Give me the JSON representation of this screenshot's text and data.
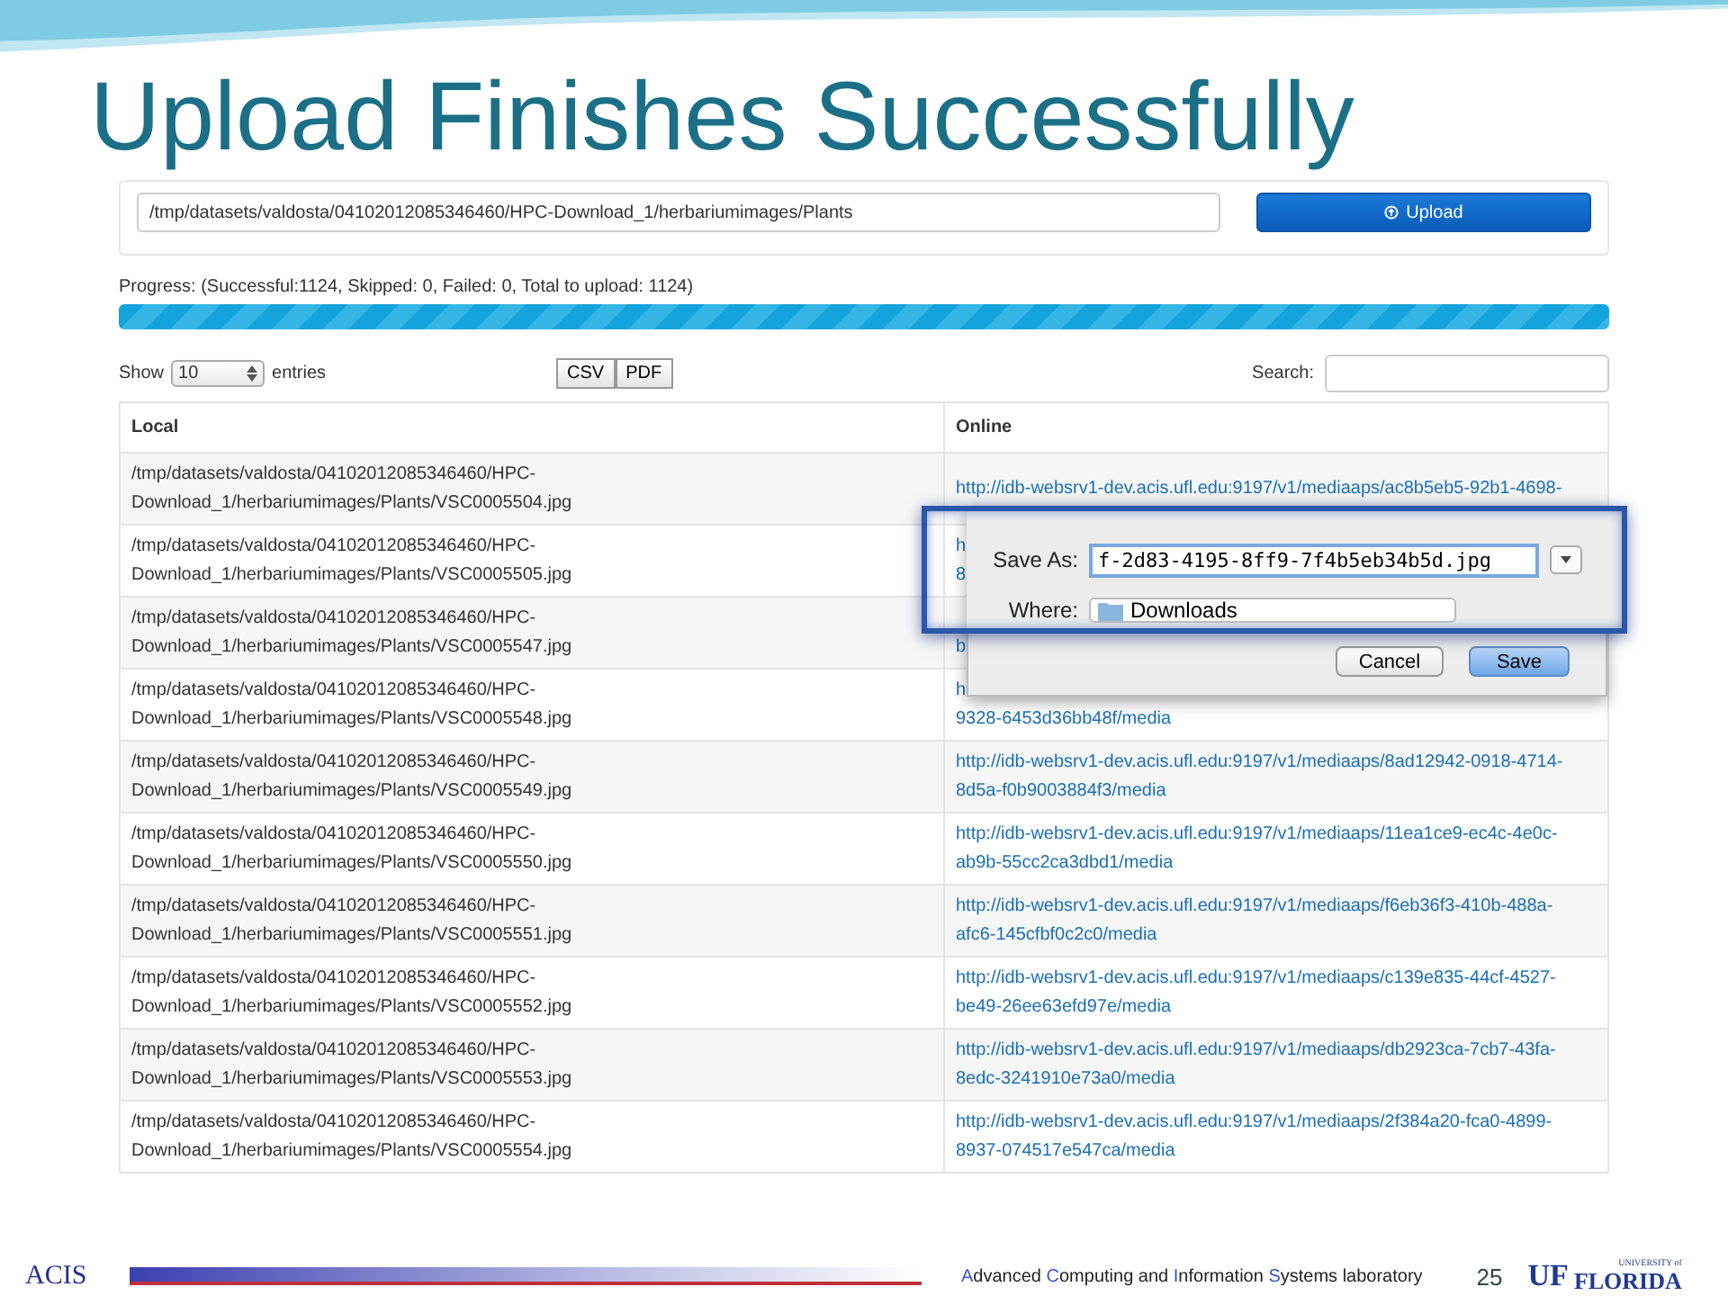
{
  "slide": {
    "title": "Upload Finishes Successfully",
    "number": "25"
  },
  "upload": {
    "path": "/tmp/datasets/valdosta/04102012085346460/HPC-Download_1/herbariumimages/Plants",
    "button": "Upload"
  },
  "progress": {
    "label": "Progress: (Successful:1124, Skipped: 0, Failed: 0, Total to upload: 1124)",
    "level": 1
  },
  "table_controls": {
    "show": "Show",
    "page_size": "10",
    "entries": "entries",
    "exports": [
      "CSV",
      "PDF"
    ],
    "search_label": "Search:"
  },
  "table": {
    "columns": [
      "Local",
      "Online"
    ],
    "rows": [
      {
        "local": "/tmp/datasets/valdosta/04102012085346460/HPC-\nDownload_1/herbariumimages/Plants/VSC0005504.jpg",
        "online": "http://idb-websrv1-dev.acis.ufl.edu:9197/v1/mediaaps/ac8b5eb5-92b1-4698-"
      },
      {
        "local": "/tmp/datasets/valdosta/04102012085346460/HPC-\nDownload_1/herbariumimages/Plants/VSC0005505.jpg",
        "online": "h\n8"
      },
      {
        "local": "/tmp/datasets/valdosta/04102012085346460/HPC-\nDownload_1/herbariumimages/Plants/VSC0005547.jpg",
        "online": "\nb"
      },
      {
        "local": "/tmp/datasets/valdosta/04102012085346460/HPC-\nDownload_1/herbariumimages/Plants/VSC0005548.jpg",
        "online": "h\n9328-6453d36bb48f/media"
      },
      {
        "local": "/tmp/datasets/valdosta/04102012085346460/HPC-\nDownload_1/herbariumimages/Plants/VSC0005549.jpg",
        "online": "http://idb-websrv1-dev.acis.ufl.edu:9197/v1/mediaaps/8ad12942-0918-4714-\n8d5a-f0b9003884f3/media"
      },
      {
        "local": "/tmp/datasets/valdosta/04102012085346460/HPC-\nDownload_1/herbariumimages/Plants/VSC0005550.jpg",
        "online": "http://idb-websrv1-dev.acis.ufl.edu:9197/v1/mediaaps/11ea1ce9-ec4c-4e0c-\nab9b-55cc2ca3dbd1/media"
      },
      {
        "local": "/tmp/datasets/valdosta/04102012085346460/HPC-\nDownload_1/herbariumimages/Plants/VSC0005551.jpg",
        "online": "http://idb-websrv1-dev.acis.ufl.edu:9197/v1/mediaaps/f6eb36f3-410b-488a-\nafc6-145cfbf0c2c0/media"
      },
      {
        "local": "/tmp/datasets/valdosta/04102012085346460/HPC-\nDownload_1/herbariumimages/Plants/VSC0005552.jpg",
        "online": "http://idb-websrv1-dev.acis.ufl.edu:9197/v1/mediaaps/c139e835-44cf-4527-\nbe49-26ee63efd97e/media"
      },
      {
        "local": "/tmp/datasets/valdosta/04102012085346460/HPC-\nDownload_1/herbariumimages/Plants/VSC0005553.jpg",
        "online": "http://idb-websrv1-dev.acis.ufl.edu:9197/v1/mediaaps/db2923ca-7cb7-43fa-\n8edc-3241910e73a0/media"
      },
      {
        "local": "/tmp/datasets/valdosta/04102012085346460/HPC-\nDownload_1/herbariumimages/Plants/VSC0005554.jpg",
        "online": "http://idb-websrv1-dev.acis.ufl.edu:9197/v1/mediaaps/2f384a20-fca0-4899-\n8937-074517e547ca/media"
      }
    ]
  },
  "save_dialog": {
    "save_as_label": "Save As:",
    "file_name": "f-2d83-4195-8ff9-7f4b5eb34b5d.jpg",
    "where_label": "Where:",
    "where": "Downloads",
    "buttons": [
      {
        "label": "Cancel",
        "default": false
      },
      {
        "label": "Save",
        "default": true
      }
    ]
  },
  "footer": {
    "left_logo": "ACIS",
    "lab_parts": [
      {
        "text": "A",
        "accent": true
      },
      {
        "text": "dvanced ",
        "accent": false
      },
      {
        "text": "C",
        "accent": true
      },
      {
        "text": "omputing and ",
        "accent": false
      },
      {
        "text": "I",
        "accent": true
      },
      {
        "text": "nformation ",
        "accent": false
      },
      {
        "text": "S",
        "accent": true
      },
      {
        "text": "ystems laboratory",
        "accent": false
      }
    ],
    "right_logo": {
      "mark": "UF",
      "top": "UNIVERSITY of",
      "bottom": "FLORIDA"
    }
  }
}
